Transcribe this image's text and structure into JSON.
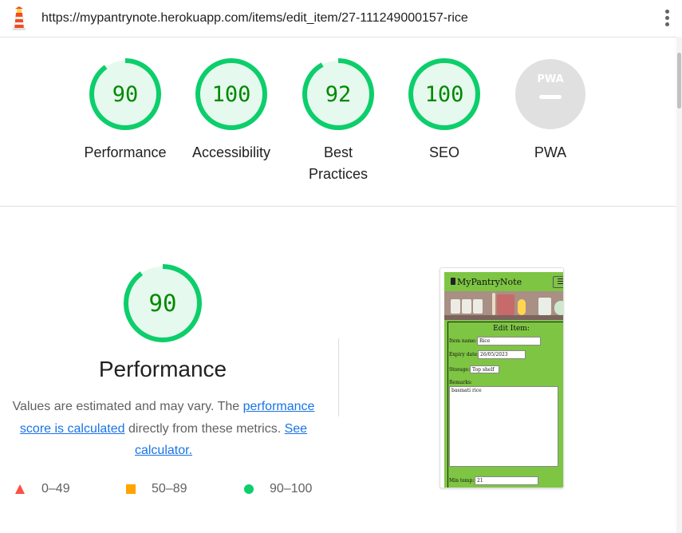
{
  "browser": {
    "url": "https://mypantrynote.herokuapp.com/items/edit_item/27-111249000157-rice",
    "menu_icon": "kebab-menu-icon",
    "logo_icon": "lighthouse-icon"
  },
  "colors": {
    "pass": "#0cce6b",
    "pass_text": "#008800",
    "pass_fill": "#e6f9ee",
    "average": "#ffa400",
    "fail": "#ff4e42",
    "na_fill": "#e0e0e0",
    "link": "#1a73e8"
  },
  "gauges": [
    {
      "label": "Performance",
      "score": "90",
      "value": 0.9
    },
    {
      "label": "Accessibility",
      "score": "100",
      "value": 1.0
    },
    {
      "label": "Best Practices",
      "score": "92",
      "value": 0.92
    },
    {
      "label": "SEO",
      "score": "100",
      "value": 1.0
    },
    {
      "label": "PWA",
      "score": "PWA",
      "value": null
    }
  ],
  "performance": {
    "score": "90",
    "value": 0.9,
    "title": "Performance",
    "desc_1": "Values are estimated and may vary. The",
    "desc_link": "performance score is calculated",
    "desc_2": "directly from these metrics.",
    "calculator_link": "See calculator."
  },
  "legend": [
    {
      "range": "0–49",
      "icon": "triangle-icon"
    },
    {
      "range": "50–89",
      "icon": "square-icon"
    },
    {
      "range": "90–100",
      "icon": "circle-icon"
    }
  ],
  "screenshot": {
    "brand": "MyPantryNote",
    "form_title": "Edit Item:",
    "item_name_label": "Item name:",
    "item_name_value": "Rice",
    "expiry_label": "Expiry date:",
    "expiry_value": "26/05/2023",
    "storage_label": "Storage:",
    "storage_value": "Top shelf",
    "remarks_label": "Remarks:",
    "remarks_value": "basmati rice",
    "min_temp_label": "Min temp:",
    "min_temp_value": "21"
  }
}
